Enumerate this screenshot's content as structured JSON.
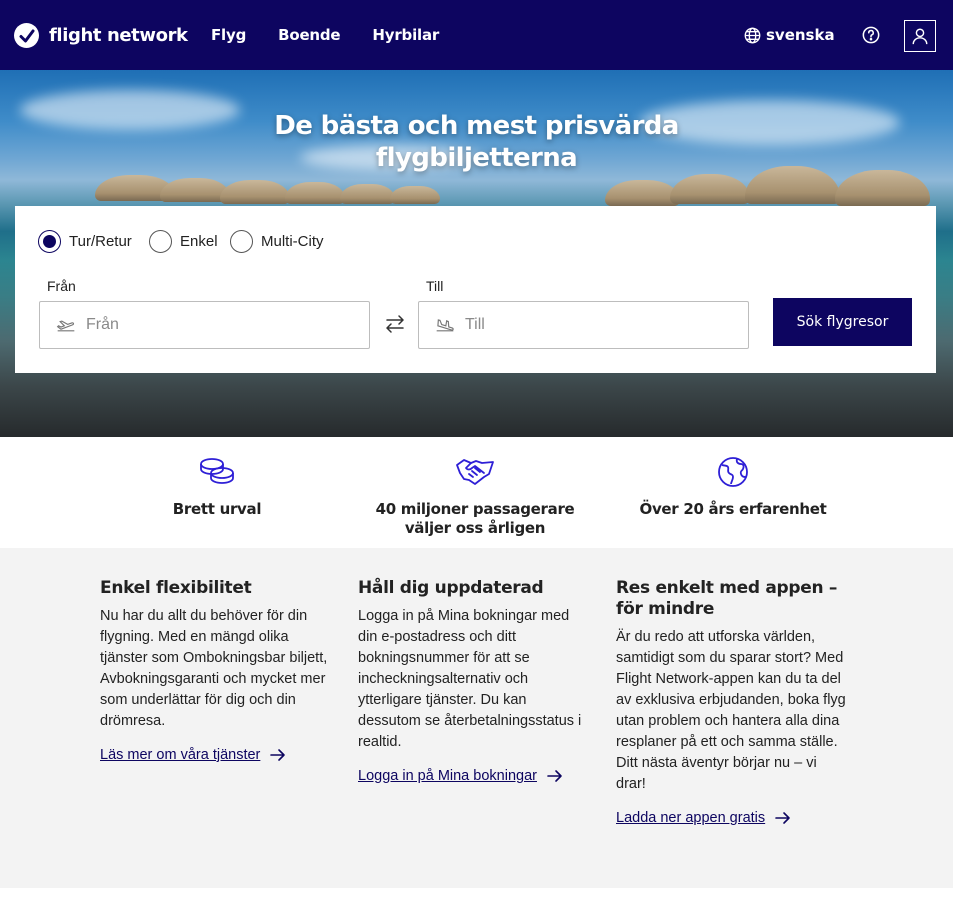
{
  "header": {
    "logo_text": "flight network",
    "nav": [
      "Flyg",
      "Boende",
      "Hyrbilar"
    ],
    "language": "svenska",
    "icons": {
      "language": "globe-icon",
      "help": "help-circle-icon",
      "account": "user-icon"
    }
  },
  "hero": {
    "title_line1": "De bästa och mest prisvärda",
    "title_line2": "flygbiljetterna"
  },
  "search": {
    "trip_types": [
      {
        "label": "Tur/Retur",
        "checked": true
      },
      {
        "label": "Enkel",
        "checked": false
      },
      {
        "label": "Multi-City",
        "checked": false
      }
    ],
    "from_label": "Från",
    "from_placeholder": "Från",
    "to_label": "Till",
    "to_placeholder": "Till",
    "button_label": "Sök flygresor"
  },
  "features": [
    {
      "icon": "coins-icon",
      "title": "Brett urval"
    },
    {
      "icon": "handshake-icon",
      "title_line1": "40 miljoner passagerare",
      "title_line2": "väljer oss årligen"
    },
    {
      "icon": "globe-icon",
      "title": "Över 20 års erfarenhet"
    }
  ],
  "info": [
    {
      "heading": "Enkel flexibilitet",
      "text": "Nu har du allt du behöver för din flygning. Med en mängd olika tjänster som Ombokningsbar biljett, Avbokningsgaranti och mycket mer som underlättar för dig och din drömresa.",
      "link": "Läs mer om våra tjänster"
    },
    {
      "heading": "Håll dig uppdaterad",
      "text": "Logga in på Mina bokningar med din e-postadress och ditt bokningsnummer för att se incheckningsalternativ och ytterligare tjänster. Du kan dessutom se återbetalningsstatus i realtid.",
      "link": "Logga in på Mina bokningar"
    },
    {
      "heading": "Res enkelt med appen – för mindre",
      "text": "Är du redo att utforska världen, samtidigt som du sparar stort? Med Flight Network-appen kan du ta del av exklusiva erbjudanden, boka flyg utan problem och hantera alla dina resplaner på ett och samma ställe. Ditt nästa äventyr börjar nu – vi drar!",
      "link": "Ladda ner appen gratis"
    }
  ],
  "colors": {
    "brand": "#0d0560",
    "info_bg": "#f3f3f3"
  }
}
